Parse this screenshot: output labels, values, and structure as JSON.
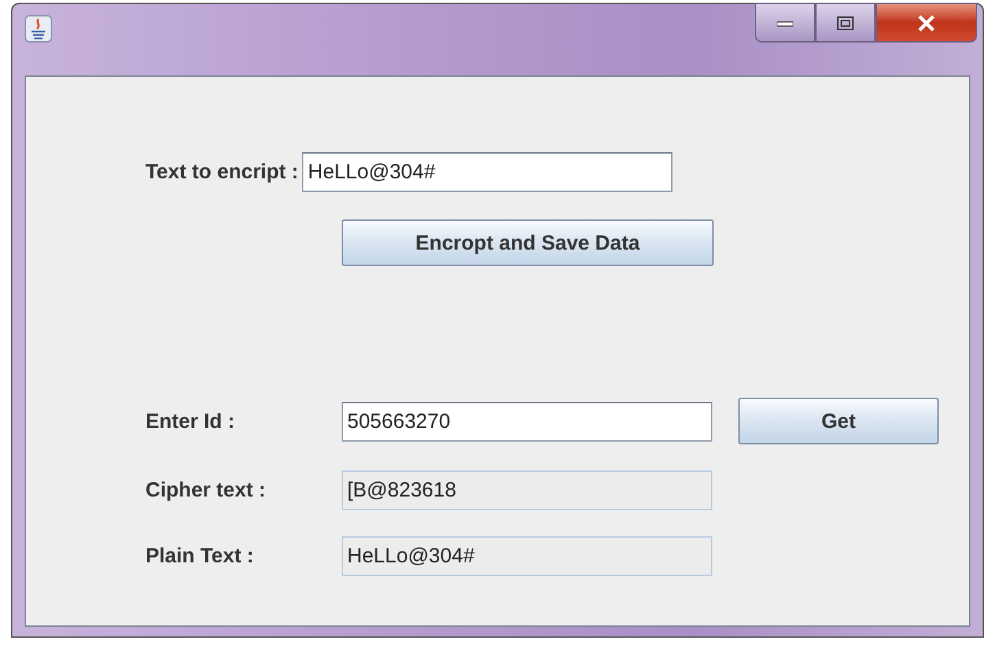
{
  "encrypt": {
    "label": "Text to encript :",
    "field": {
      "value": "HeLLo@304#",
      "editable": true
    },
    "button": "Encropt and Save Data"
  },
  "lookup": [
    {
      "label": "Enter Id :",
      "field": {
        "value": "505663270",
        "editable": true
      },
      "button": "Get"
    },
    {
      "label": "Cipher text :",
      "field": {
        "value": "[B@823618",
        "editable": false
      }
    },
    {
      "label": "Plain Text :",
      "field": {
        "value": "HeLLo@304#",
        "editable": false
      }
    }
  ]
}
